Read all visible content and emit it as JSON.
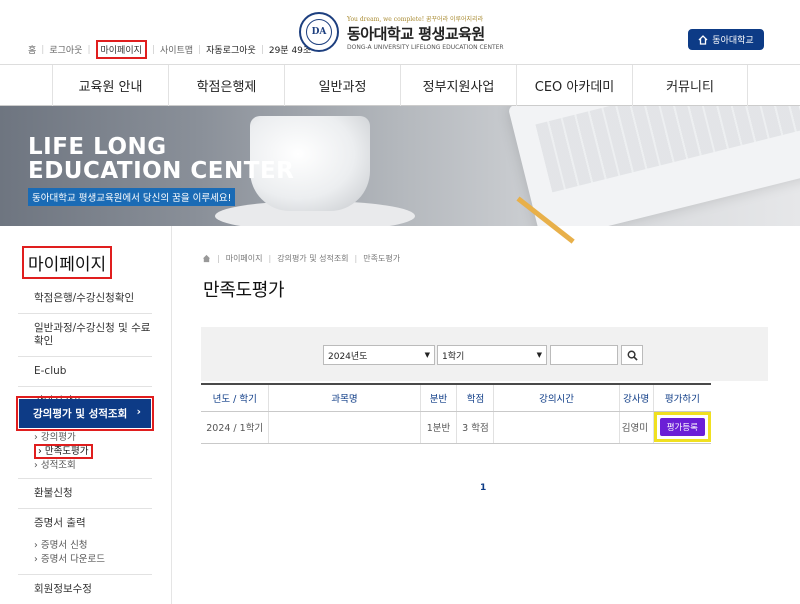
{
  "util": {
    "home": "홈",
    "logout": "로그아웃",
    "mypage": "마이페이지",
    "sitemap": "사이트맵",
    "auto_logout_label": "자동로그아웃",
    "timer": "29분 49초"
  },
  "logo": {
    "seal_text": "DA",
    "tagline": "You dream, we complete! 꿈꾸어라 이루어지리라",
    "name": "동아대학교 평생교육원",
    "sub": "DONG-A UNIVERSITY LIFELONG EDUCATION CENTER"
  },
  "home_button": {
    "label": "동아대학교"
  },
  "gnb": [
    "교육원 안내",
    "학점은행제",
    "일반과정",
    "정부지원사업",
    "CEO 아카데미",
    "커뮤니티"
  ],
  "banner": {
    "line1": "LIFE LONG",
    "line2": "EDUCATION CENTER",
    "slogan": "동아대학교 평생교육원에서 당신의 꿈을 이루세요!"
  },
  "sidebar": {
    "title": "마이페이지",
    "items": [
      "학점은행/수강신청확인",
      "일반과정/수강신청 및 수료확인",
      "E-club",
      "강의시간표"
    ],
    "active": "강의평가 및 성적조회",
    "active_arrow": "›",
    "subs": [
      "강의평가",
      "만족도평가",
      "성적조회"
    ],
    "items2": [
      "환불신청",
      "증명서 출력"
    ],
    "subs2": [
      "증명서 신청",
      "증명서 다운로드"
    ],
    "items3": [
      "회원정보수정"
    ]
  },
  "breadcrumb": [
    "마이페이지",
    "강의평가 및 성적조회",
    "만족도평가"
  ],
  "page_title": "만족도평가",
  "search": {
    "year": "2024년도",
    "term": "1학기",
    "input_value": ""
  },
  "table": {
    "headers": [
      "년도 / 학기",
      "과목명",
      "분반",
      "학점",
      "강의시간",
      "강사명",
      "평가하기"
    ],
    "rows": [
      {
        "term": "2024 / 1학기",
        "subject": "",
        "class": "1분반",
        "credit": "3 학점",
        "time": "",
        "teacher": "김영미",
        "action": "평가등록"
      }
    ]
  },
  "pagination": {
    "current": "1"
  },
  "colors": {
    "navy": "#0d3b86",
    "highlight_red": "#e01e1e",
    "eval_purple": "#6b1fd6",
    "highlight_yellow": "#f0e020"
  }
}
